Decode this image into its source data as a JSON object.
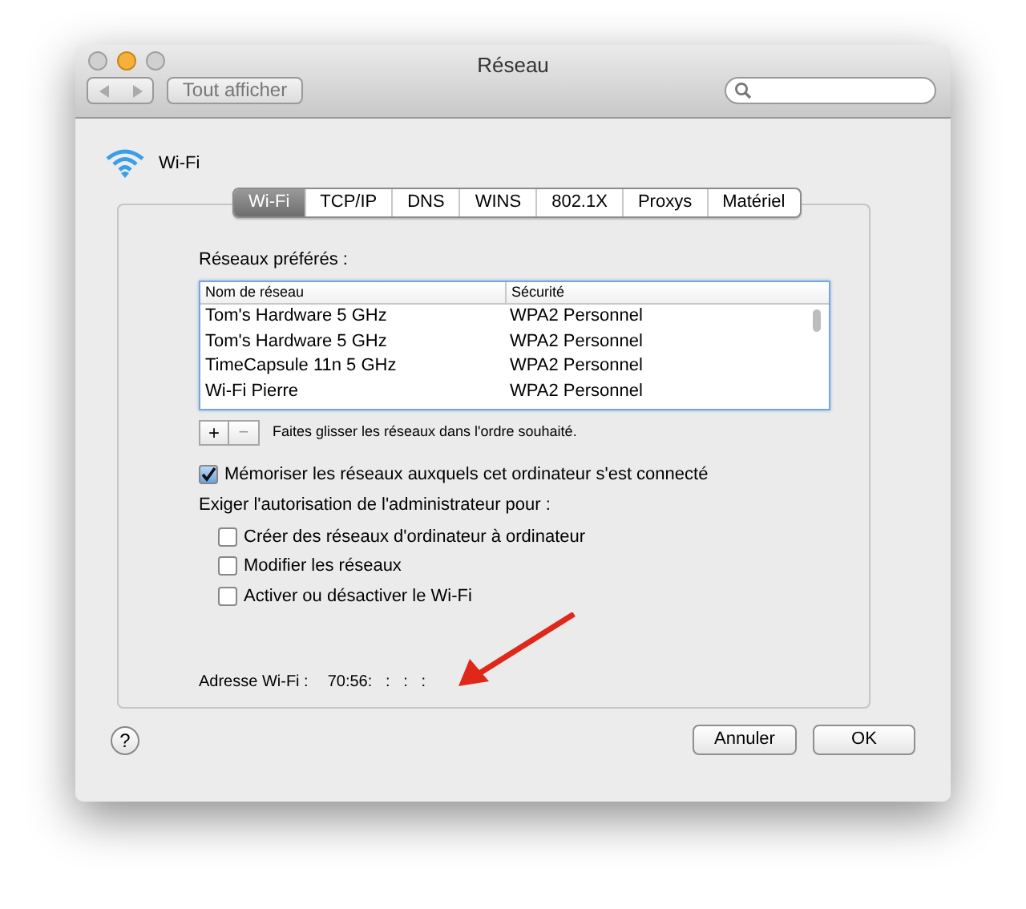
{
  "window": {
    "title": "Réseau"
  },
  "toolbar": {
    "show_all_button": "Tout afficher"
  },
  "service": {
    "name": "Wi-Fi"
  },
  "tabs": [
    {
      "label": "Wi-Fi",
      "selected": true
    },
    {
      "label": "TCP/IP",
      "selected": false
    },
    {
      "label": "DNS",
      "selected": false
    },
    {
      "label": "WINS",
      "selected": false
    },
    {
      "label": "802.1X",
      "selected": false
    },
    {
      "label": "Proxys",
      "selected": false
    },
    {
      "label": "Matériel",
      "selected": false
    }
  ],
  "preferred_networks": {
    "label": "Réseaux préférés :",
    "columns": [
      "Nom de réseau",
      "Sécurité"
    ],
    "rows": [
      [
        "Tom's Hardware 5 GHz",
        "WPA2 Personnel"
      ],
      [
        "Tom's Hardware 5 GHz",
        "WPA2 Personnel"
      ],
      [
        "TimeCapsule 11n 5 GHz",
        "WPA2 Personnel"
      ],
      [
        "Wi-Fi Pierre",
        "WPA2 Personnel"
      ]
    ],
    "add_button": "+",
    "remove_button": "−",
    "hint": "Faites glisser les réseaux dans l'ordre souhaité."
  },
  "remember_option": {
    "label": "Mémoriser les réseaux auxquels cet ordinateur s'est connecté",
    "checked": true
  },
  "admin_heading": "Exiger l'autorisation de l'administrateur pour :",
  "admin_options": [
    {
      "label": "Créer des réseaux d'ordinateur à ordinateur",
      "checked": false
    },
    {
      "label": "Modifier les réseaux",
      "checked": false
    },
    {
      "label": "Activer ou désactiver le Wi-Fi",
      "checked": false
    }
  ],
  "address": {
    "label": "Adresse Wi-Fi :",
    "value": "70:56:   :   :   :"
  },
  "help_button": "?",
  "buttons": [
    {
      "label": "Annuler",
      "kind": "cancel"
    },
    {
      "label": "OK",
      "kind": "ok"
    }
  ]
}
